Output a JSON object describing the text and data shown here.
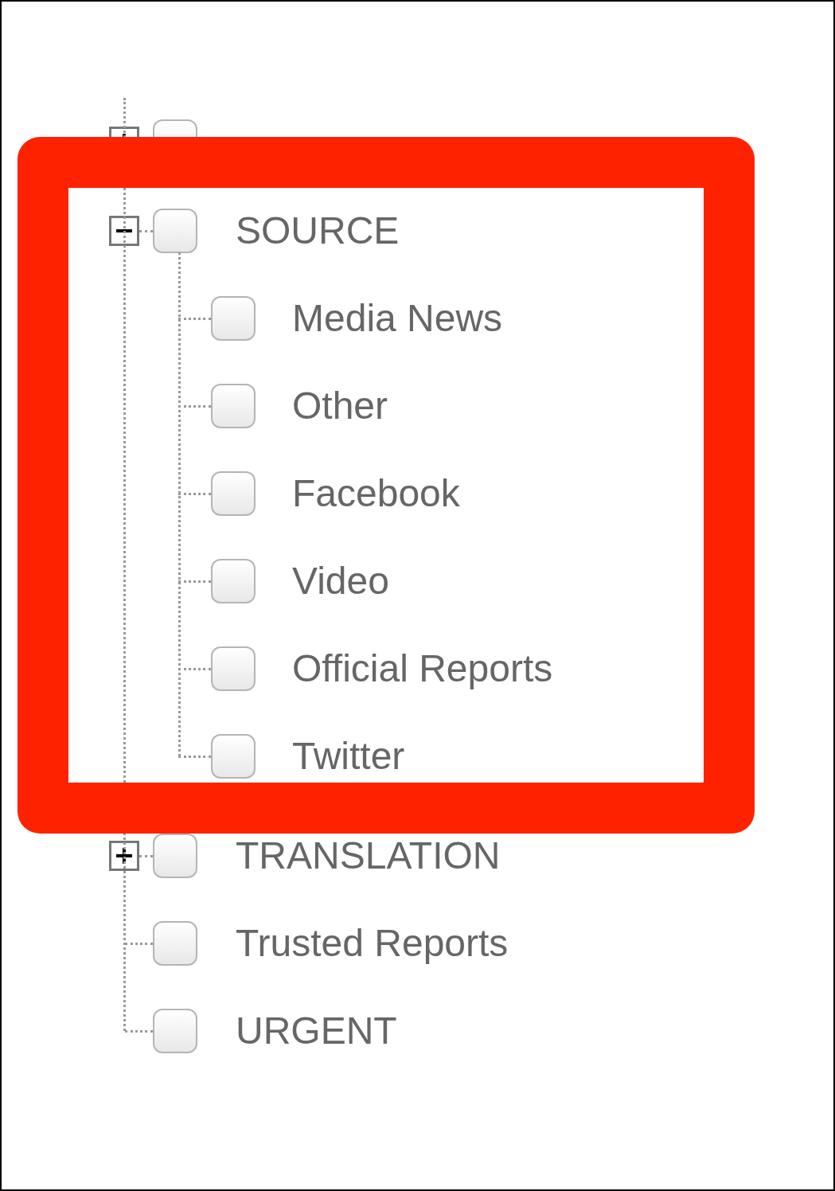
{
  "tree": [
    {
      "checked": false,
      "expanded": false
    },
    {
      "label": "SOURCE",
      "checked": false,
      "expanded": true,
      "children": [
        {
          "label": "Media News",
          "checked": false
        },
        {
          "label": "Other",
          "checked": false
        },
        {
          "label": "Facebook",
          "checked": false
        },
        {
          "label": "Video",
          "checked": false
        },
        {
          "label": "Official Reports",
          "checked": false
        },
        {
          "label": "Twitter",
          "checked": false
        }
      ]
    },
    {
      "label": "TRANSLATION",
      "checked": false,
      "expanded": false
    },
    {
      "label": "Trusted Reports",
      "checked": false
    },
    {
      "label": "URGENT",
      "checked": false
    }
  ]
}
